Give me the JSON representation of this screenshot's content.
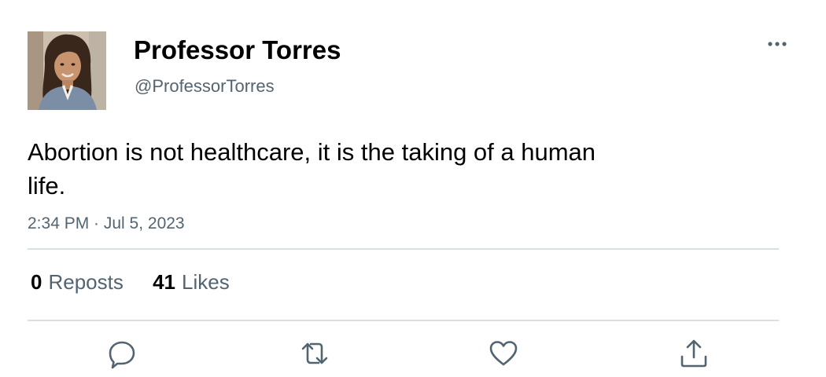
{
  "author": {
    "display_name": "Professor Torres",
    "handle": "@ProfessorTorres",
    "avatar_icon": "profile-photo"
  },
  "tweet": {
    "text": "Abortion is not healthcare, it is the taking of a human life.",
    "timestamp": "2:34 PM · Jul 5, 2023"
  },
  "stats": {
    "reposts_count": "0",
    "reposts_label": "Reposts",
    "likes_count": "41",
    "likes_label": "Likes"
  },
  "actions": {
    "reply_icon": "reply-icon",
    "repost_icon": "repost-icon",
    "like_icon": "heart-icon",
    "share_icon": "share-icon",
    "more_icon": "more-options-icon"
  },
  "colors": {
    "text_primary": "#000000",
    "text_secondary": "#536471",
    "divider": "#dadfe3",
    "icon": "#536471"
  }
}
